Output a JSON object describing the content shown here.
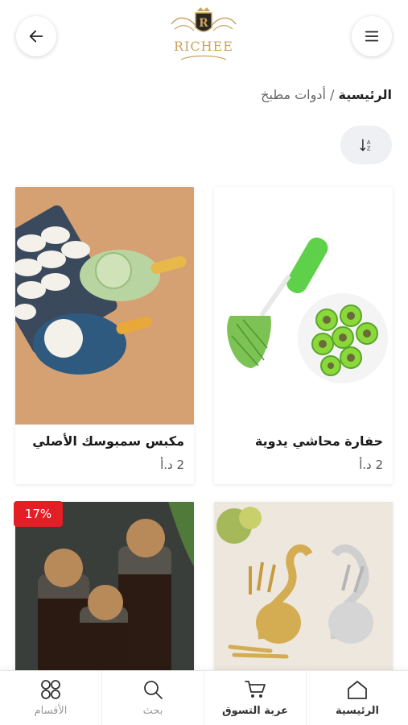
{
  "header": {
    "logo_text": "RICHEE",
    "logo_letter": "R"
  },
  "breadcrumb": {
    "home": "الرئيسية",
    "separator": "/",
    "current": "أدوات مطبخ"
  },
  "products": [
    {
      "name": "حفارة محاشي يدوية",
      "price": "2 د.أ"
    },
    {
      "name": "مكبس سمبوسك الأصلي",
      "price": "2 د.أ"
    },
    {
      "name": "",
      "price": ""
    },
    {
      "name": "",
      "price": "",
      "discount": "17%"
    }
  ],
  "bottom_nav": {
    "home": "الرئيسية",
    "cart": "عربة التسوق",
    "search": "بحث",
    "categories": "الأقسام"
  },
  "colors": {
    "accent_gold": "#c9a45f",
    "badge_red": "#e31e24"
  }
}
